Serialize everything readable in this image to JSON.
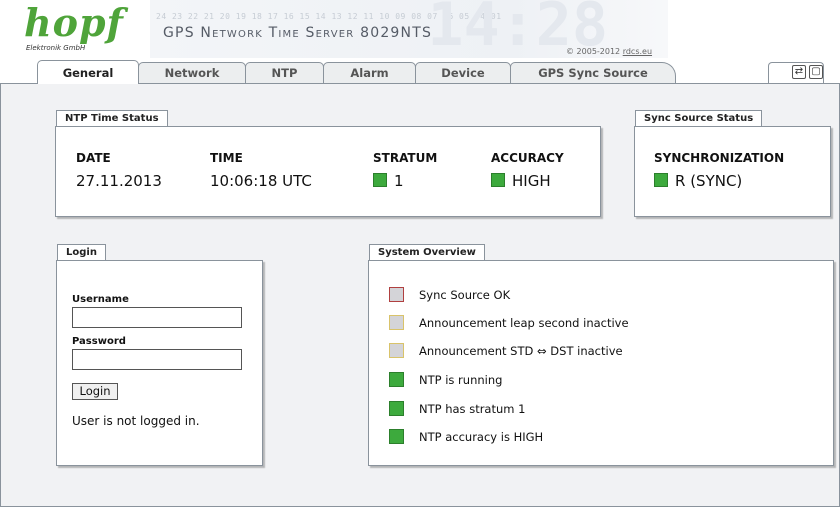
{
  "header": {
    "logo_text": "hopf",
    "logo_subtext": "Elektronik GmbH",
    "title": "GPS Network Time Server 8029NTS",
    "copyright_prefix": "© 2005-2012",
    "copyright_link": "rdcs.eu",
    "ticker_digits": "24 23 22 21 20 19 18 17 16 15 14 13 12 11 10 09 08 07 06 05 04 01",
    "background_digits": "14:28"
  },
  "tabs": [
    {
      "label": "General",
      "active": true
    },
    {
      "label": "Network",
      "active": false
    },
    {
      "label": "NTP",
      "active": false
    },
    {
      "label": "Alarm",
      "active": false
    },
    {
      "label": "Device",
      "active": false
    },
    {
      "label": "GPS Sync Source",
      "active": false
    }
  ],
  "tab_icons": {
    "refresh": "refresh-icon",
    "window": "window-icon"
  },
  "ntp_status": {
    "legend": "NTP Time Status",
    "date_label": "DATE",
    "date_value": "27.11.2013",
    "time_label": "TIME",
    "time_value": "10:06:18 UTC",
    "stratum_label": "STRATUM",
    "stratum_value": "1",
    "accuracy_label": "ACCURACY",
    "accuracy_value": "HIGH"
  },
  "sync_status": {
    "legend": "Sync Source Status",
    "sync_label": "SYNCHRONIZATION",
    "sync_value": "R (SYNC)"
  },
  "login": {
    "legend": "Login",
    "username_label": "Username",
    "username_value": "",
    "password_label": "Password",
    "password_value": "",
    "button_label": "Login",
    "status_text": "User is not logged in."
  },
  "system_overview": {
    "legend": "System Overview",
    "items": [
      {
        "text": "Sync Source OK",
        "state": "inactive-red"
      },
      {
        "text": "Announcement leap second inactive",
        "state": "inactive-yellow"
      },
      {
        "text": "Announcement STD ⇔ DST inactive",
        "state": "inactive-yellow"
      },
      {
        "text": "NTP is running",
        "state": "ok"
      },
      {
        "text": "NTP has stratum 1",
        "state": "ok"
      },
      {
        "text": "NTP accuracy is HIGH",
        "state": "ok"
      }
    ]
  },
  "colors": {
    "led_green": "#3daa3d",
    "led_inactive_fill": "#d4d4d8",
    "led_red_border": "#b04040",
    "led_yellow_border": "#d9c36a",
    "logo_green": "#4fa43a"
  }
}
